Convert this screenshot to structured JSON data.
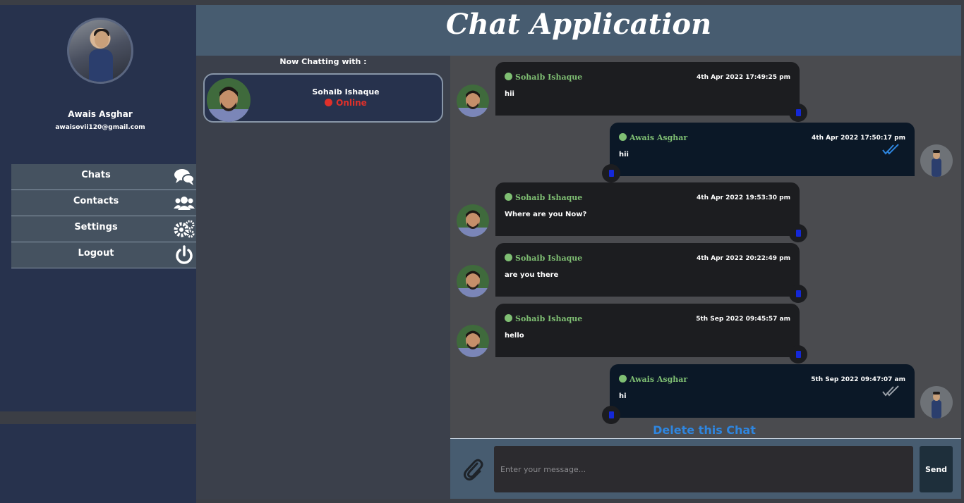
{
  "app": {
    "title": "Chat Application"
  },
  "profile": {
    "name": "Awais Asghar",
    "email": "awaisovii120@gmail.com"
  },
  "menu": {
    "items": [
      {
        "label": "Chats",
        "icon": "chat-bubbles-icon"
      },
      {
        "label": "Contacts",
        "icon": "users-icon"
      },
      {
        "label": "Settings",
        "icon": "gears-icon"
      },
      {
        "label": "Logout",
        "icon": "power-icon"
      }
    ]
  },
  "contacts": {
    "heading": "Now Chatting with :",
    "active": {
      "name": "Sohaib Ishaque",
      "status": "Online",
      "status_color": "#e0302a"
    }
  },
  "messages": [
    {
      "direction": "in",
      "sender": "Sohaib Ishaque",
      "time": "4th Apr 2022 17:49:25 pm",
      "text": "hii"
    },
    {
      "direction": "out",
      "sender": "Awais Asghar",
      "time": "4th Apr 2022 17:50:17 pm",
      "text": "hii",
      "read": true
    },
    {
      "direction": "in",
      "sender": "Sohaib Ishaque",
      "time": "4th Apr 2022 19:53:30 pm",
      "text": "Where are you Now?"
    },
    {
      "direction": "in",
      "sender": "Sohaib Ishaque",
      "time": "4th Apr 2022 20:22:49 pm",
      "text": "are you there"
    },
    {
      "direction": "in",
      "sender": "Sohaib Ishaque",
      "time": "5th Sep 2022 09:45:57 am",
      "text": "hello"
    },
    {
      "direction": "out",
      "sender": "Awais Asghar",
      "time": "5th Sep 2022 09:47:07 am",
      "text": "hi",
      "read": false
    }
  ],
  "chat": {
    "delete_label": "Delete this Chat"
  },
  "composer": {
    "placeholder": "Enter your message...",
    "send_label": "Send"
  },
  "colors": {
    "sidebar": "#27324d",
    "header": "#475c70",
    "sender_name": "#7fbf73",
    "read_check": "#2e86e0",
    "unread_check": "#9aa0a8",
    "delete_link": "#2e86e0"
  }
}
